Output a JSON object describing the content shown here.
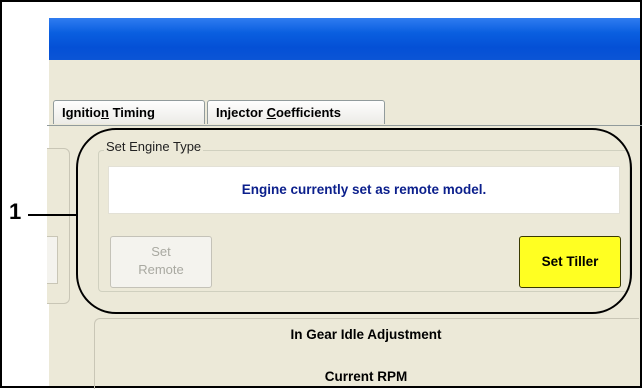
{
  "tabs": [
    {
      "pre": "Ignitio",
      "u": "n",
      "post": " Timing"
    },
    {
      "pre": "Injector ",
      "u": "C",
      "post": "oefficients"
    }
  ],
  "engine_group": {
    "legend": "Set Engine Type",
    "status": "Engine currently set as remote model.",
    "set_remote_line1": "Set",
    "set_remote_line2": "Remote",
    "set_tiller": "Set Tiller"
  },
  "callout": {
    "number": "1"
  },
  "lower": {
    "title": "In Gear Idle Adjustment",
    "rpm_label": "Current RPM"
  },
  "colors": {
    "titlebar": "#0450d6",
    "dialog_bg": "#ece9d8",
    "status_text": "#0b1f8c",
    "tiller_button": "#ffff22"
  }
}
